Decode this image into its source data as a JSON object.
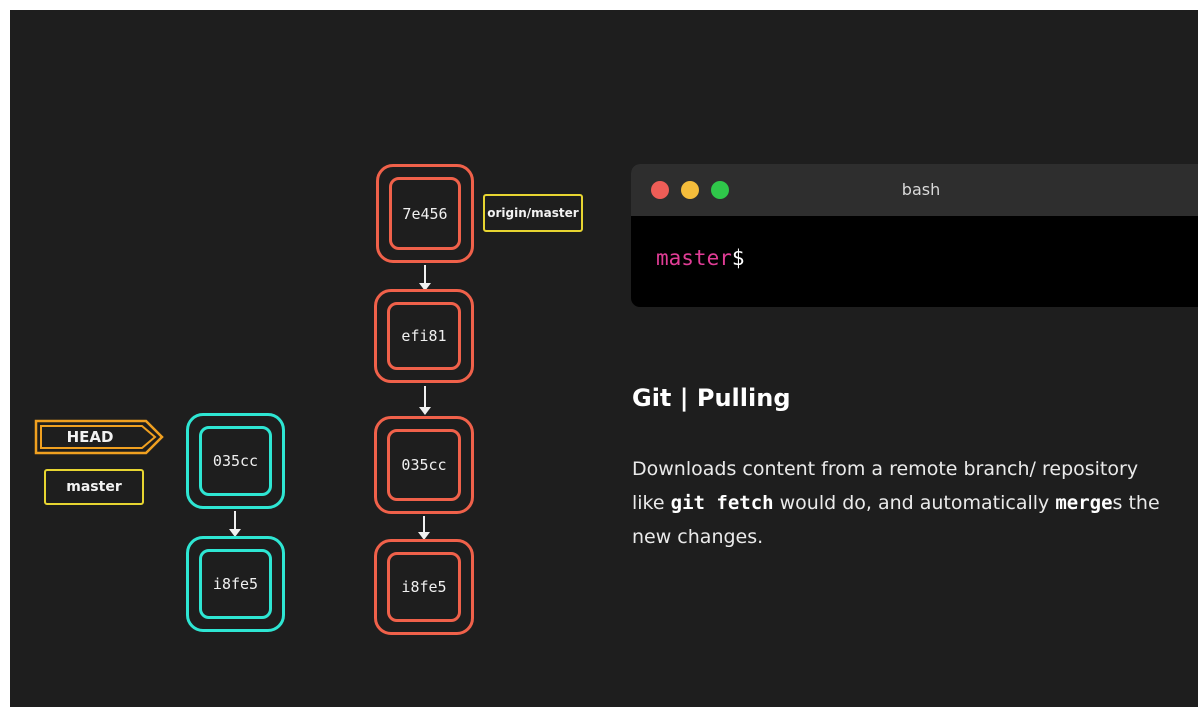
{
  "local_branch": {
    "head_label": "HEAD",
    "branch_label": "master",
    "commits": [
      "035cc",
      "i8fe5"
    ]
  },
  "remote_branch": {
    "branch_label": "origin/master",
    "commits": [
      "7e456",
      "efi81",
      "035cc",
      "i8fe5"
    ]
  },
  "terminal": {
    "title": "bash",
    "prompt_branch": "master",
    "prompt_symbol": "$",
    "dot_colors": [
      "#ee5d57",
      "#f5bd3b",
      "#2fc74a"
    ]
  },
  "info": {
    "title": "Git | Pulling",
    "description": [
      {
        "text": "Downloads content from a remote branch/ repository like ",
        "code": false
      },
      {
        "text": "git fetch",
        "code": true
      },
      {
        "text": " would do, and automatically ",
        "code": false
      },
      {
        "text": "merge",
        "code": true
      },
      {
        "text": "s the new changes.",
        "code": false
      }
    ]
  },
  "colors": {
    "local_commit": "#2ee6d3",
    "remote_commit": "#f0614a",
    "label_border": "#e7d531",
    "head_arrow": "#f0a020",
    "prompt_text": "#e13d96",
    "background": "#1e1e1e"
  }
}
